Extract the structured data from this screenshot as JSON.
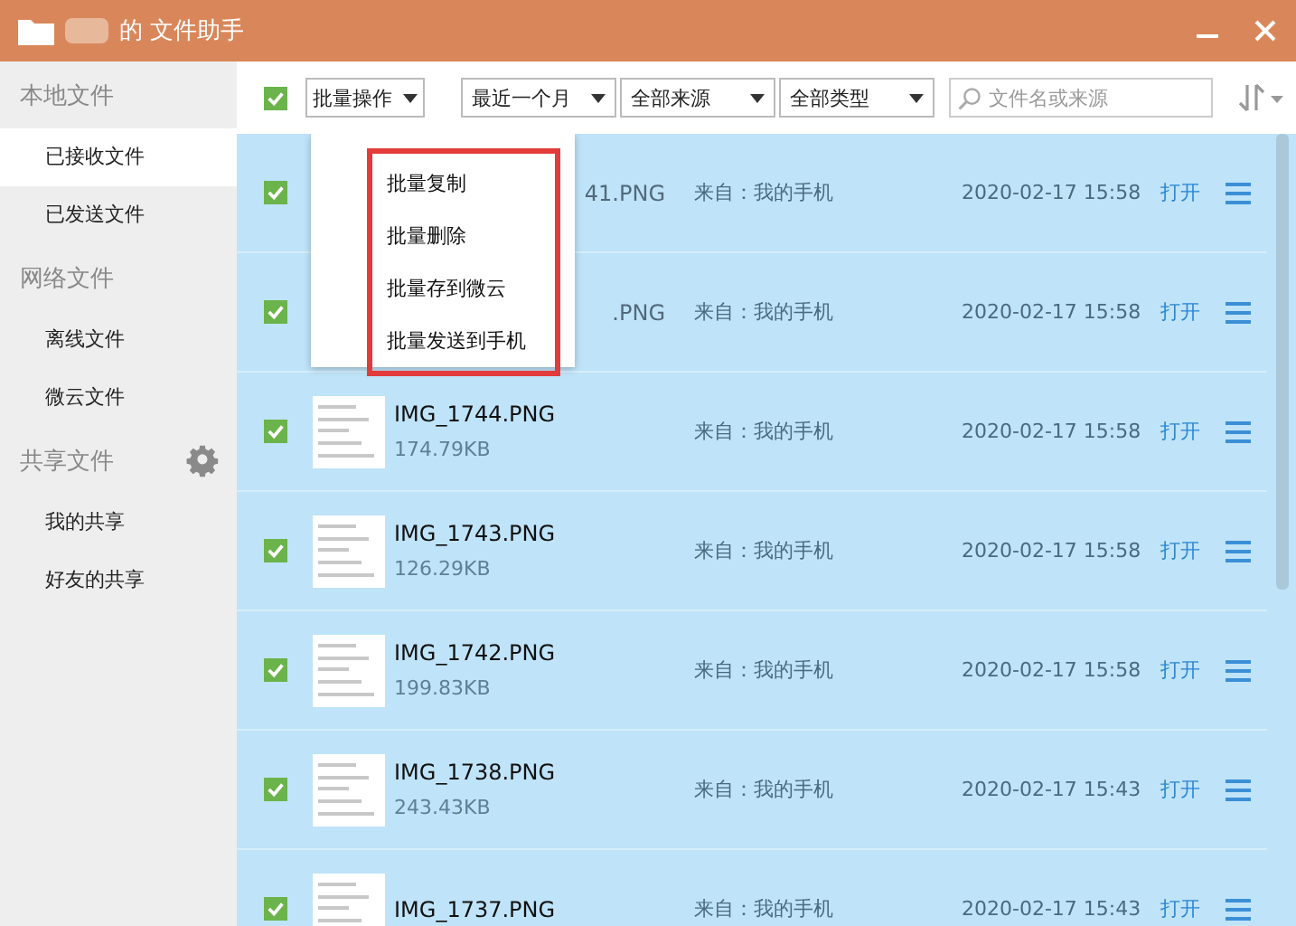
{
  "window": {
    "title": "的 文件助手"
  },
  "sidebar": {
    "groups": [
      {
        "label": "本地文件",
        "settings": false,
        "items": [
          {
            "label": "已接收文件",
            "selected": true
          },
          {
            "label": "已发送文件",
            "selected": false
          }
        ]
      },
      {
        "label": "网络文件",
        "settings": false,
        "items": [
          {
            "label": "离线文件",
            "selected": false
          },
          {
            "label": "微云文件",
            "selected": false
          }
        ]
      },
      {
        "label": "共享文件",
        "settings": true,
        "items": [
          {
            "label": "我的共享",
            "selected": false
          },
          {
            "label": "好友的共享",
            "selected": false
          }
        ]
      }
    ]
  },
  "toolbar": {
    "select_all": {
      "checked": true
    },
    "batch_button": "批量操作",
    "filters": [
      "最近一个月",
      "全部来源",
      "全部类型"
    ],
    "search": {
      "placeholder": "文件名或来源"
    }
  },
  "batch_menu": {
    "items": [
      "批量复制",
      "批量删除",
      "批量存到微云",
      "批量发送到手机"
    ]
  },
  "files": [
    {
      "kind": "covered",
      "name": "41.PNG",
      "checked": true,
      "source": "来自：我的手机",
      "time": "2020-02-17 15:58",
      "action": "打开"
    },
    {
      "kind": "covered",
      "name": ".PNG",
      "checked": true,
      "source": "来自：我的手机",
      "time": "2020-02-17 15:58",
      "action": "打开"
    },
    {
      "kind": "full",
      "name": "IMG_1744.PNG",
      "size": "174.79KB",
      "checked": true,
      "source": "来自：我的手机",
      "time": "2020-02-17 15:58",
      "action": "打开"
    },
    {
      "kind": "full",
      "name": "IMG_1743.PNG",
      "size": "126.29KB",
      "checked": true,
      "source": "来自：我的手机",
      "time": "2020-02-17 15:58",
      "action": "打开"
    },
    {
      "kind": "full",
      "name": "IMG_1742.PNG",
      "size": "199.83KB",
      "checked": true,
      "source": "来自：我的手机",
      "time": "2020-02-17 15:58",
      "action": "打开"
    },
    {
      "kind": "full",
      "name": "IMG_1738.PNG",
      "size": "243.43KB",
      "checked": true,
      "source": "来自：我的手机",
      "time": "2020-02-17 15:43",
      "action": "打开"
    },
    {
      "kind": "full",
      "name": "IMG_1737.PNG",
      "checked": true,
      "source": "来自：我的手机",
      "time": "2020-02-17 15:43",
      "action": "打开"
    }
  ]
}
